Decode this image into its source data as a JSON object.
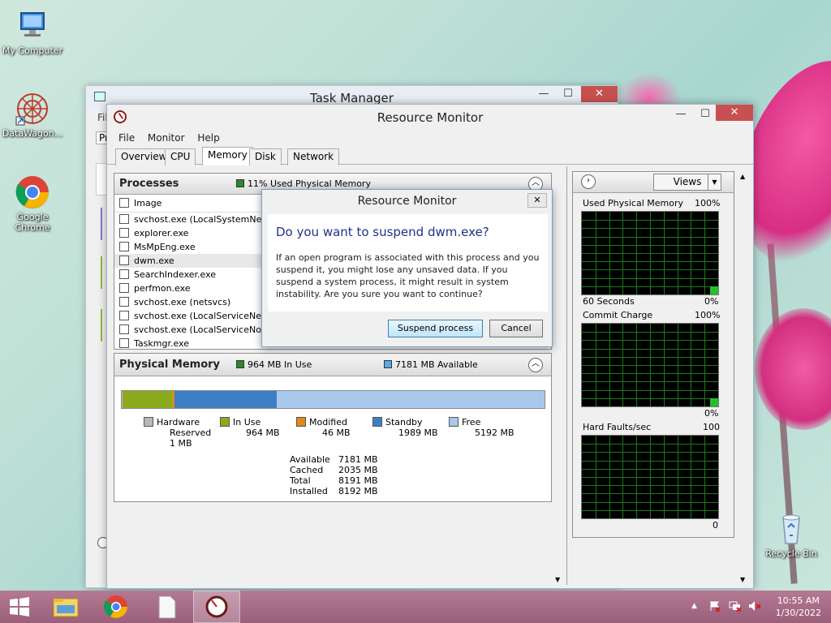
{
  "desktop": {
    "icons": [
      {
        "label": "My Computer"
      },
      {
        "label": "DataWagon..."
      },
      {
        "label": "Google Chrome"
      },
      {
        "label": "Recycle Bin"
      }
    ]
  },
  "task_manager": {
    "title": "Task Manager",
    "minimize": "—",
    "maximize": "☐",
    "close": "✕",
    "menu_fragment": "Fil",
    "tab_fragment": "Pr"
  },
  "resource_monitor": {
    "title": "Resource Monitor",
    "minimize": "—",
    "maximize": "☐",
    "close": "✕",
    "menu": [
      "File",
      "Monitor",
      "Help"
    ],
    "tabs": [
      "Overview",
      "CPU",
      "Memory",
      "Disk",
      "Network"
    ],
    "active_tab": "Memory",
    "processes": {
      "title": "Processes",
      "status": "11% Used Physical Memory",
      "column_image": "Image",
      "rows": [
        "svchost.exe (LocalSystemNet...",
        "explorer.exe",
        "MsMpEng.exe",
        "dwm.exe",
        "SearchIndexer.exe",
        "perfmon.exe",
        "svchost.exe (netsvcs)",
        "svchost.exe (LocalServiceNet...",
        "svchost.exe (LocalServiceNo...",
        "Taskmgr.exe"
      ],
      "highlighted_row": "dwm.exe"
    },
    "physical_memory": {
      "title": "Physical Memory",
      "in_use": "964 MB In Use",
      "available": "7181 MB Available",
      "bar": {
        "hardware_reserved_mb": 1,
        "in_use_mb": 964,
        "modified_mb": 46,
        "standby_mb": 1989,
        "free_mb": 5192
      },
      "legend": [
        {
          "label1": "Hardware",
          "label2": "Reserved",
          "value": "1 MB",
          "color": "#b8b8b8"
        },
        {
          "label1": "In Use",
          "label2": "",
          "value": "964 MB",
          "color": "#8caa1e"
        },
        {
          "label1": "Modified",
          "label2": "",
          "value": "46 MB",
          "color": "#e08a1e"
        },
        {
          "label1": "Standby",
          "label2": "",
          "value": "1989 MB",
          "color": "#3d7fc4"
        },
        {
          "label1": "Free",
          "label2": "",
          "value": "5192 MB",
          "color": "#a8c8ec"
        }
      ],
      "stats": [
        {
          "label": "Available",
          "value": "7181 MB"
        },
        {
          "label": "Cached",
          "value": "2035 MB"
        },
        {
          "label": "Total",
          "value": "8191 MB"
        },
        {
          "label": "Installed",
          "value": "8192 MB"
        }
      ]
    },
    "graphs": {
      "views_label": "Views",
      "used_physical": {
        "title": "Used Physical Memory",
        "max": "100%",
        "xlabel": "60 Seconds",
        "min": "0%"
      },
      "commit_charge": {
        "title": "Commit Charge",
        "max": "100%",
        "min": "0%"
      },
      "hard_faults": {
        "title": "Hard Faults/sec",
        "max": "100",
        "min": "0"
      }
    }
  },
  "dialog": {
    "title": "Resource Monitor",
    "close": "✕",
    "question": "Do you want to suspend dwm.exe?",
    "text": "If an open program is associated with this process and you suspend it, you might lose any unsaved data. If you suspend a system process, it might result in system instability. Are you sure you want to continue?",
    "primary": "Suspend process",
    "cancel": "Cancel"
  },
  "taskbar": {
    "time": "10:55 AM",
    "date": "1/30/2022"
  },
  "colors": {
    "graph_bg": "#000000",
    "graph_grid": "#1a7a1a",
    "graph_fill": "#25c025"
  }
}
